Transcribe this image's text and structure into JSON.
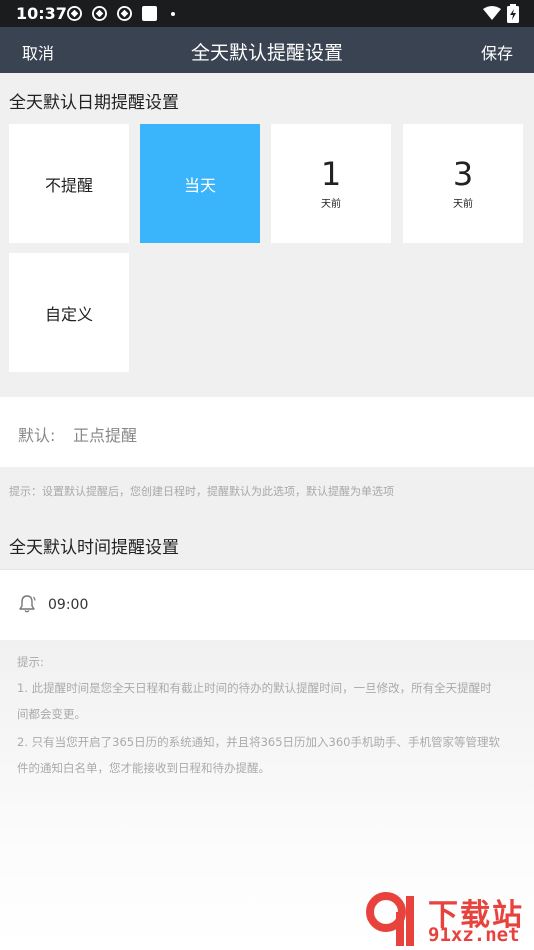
{
  "status_bar": {
    "time": "10:37",
    "icons": [
      "app-icon",
      "app-icon",
      "app-icon",
      "square-icon",
      "dot-icon",
      "wifi-icon",
      "battery-icon"
    ]
  },
  "header": {
    "cancel_label": "取消",
    "title": "全天默认提醒设置",
    "save_label": "保存",
    "background": "#3a4352"
  },
  "date_settings": {
    "title": "全天默认日期提醒设置",
    "options": [
      {
        "label": "不提醒",
        "selected": false
      },
      {
        "label": "当天",
        "selected": true
      },
      {
        "number": "1",
        "unit": "天前",
        "selected": false
      },
      {
        "number": "3",
        "unit": "天前",
        "selected": false
      },
      {
        "label": "自定义",
        "selected": false
      }
    ],
    "selected_color": "#3ab4fb"
  },
  "default_row": {
    "label": "默认:",
    "value": "正点提醒"
  },
  "date_hint": "提示：设置默认提醒后，您创建日程时，提醒默认为此选项，默认提醒为单选项",
  "time_settings": {
    "title": "全天默认时间提醒设置",
    "icon": "bell-icon",
    "time": "09:00"
  },
  "hints": {
    "heading": "提示:",
    "line1": "1. 此提醒时间是您全天日程和有截止时间的待办的默认提醒时间，一旦修改，所有全天提醒时",
    "line2": "间都会变更。",
    "line3": "2. 只有当您开启了365日历的系统通知，并且将365日历加入360手机助手、手机管家等管理软",
    "line4": "件的通知白名单，您才能接收到日程和待办提醒。"
  },
  "watermark": {
    "text": "下载站",
    "url": "91xz.net",
    "color": "#e8423d"
  }
}
